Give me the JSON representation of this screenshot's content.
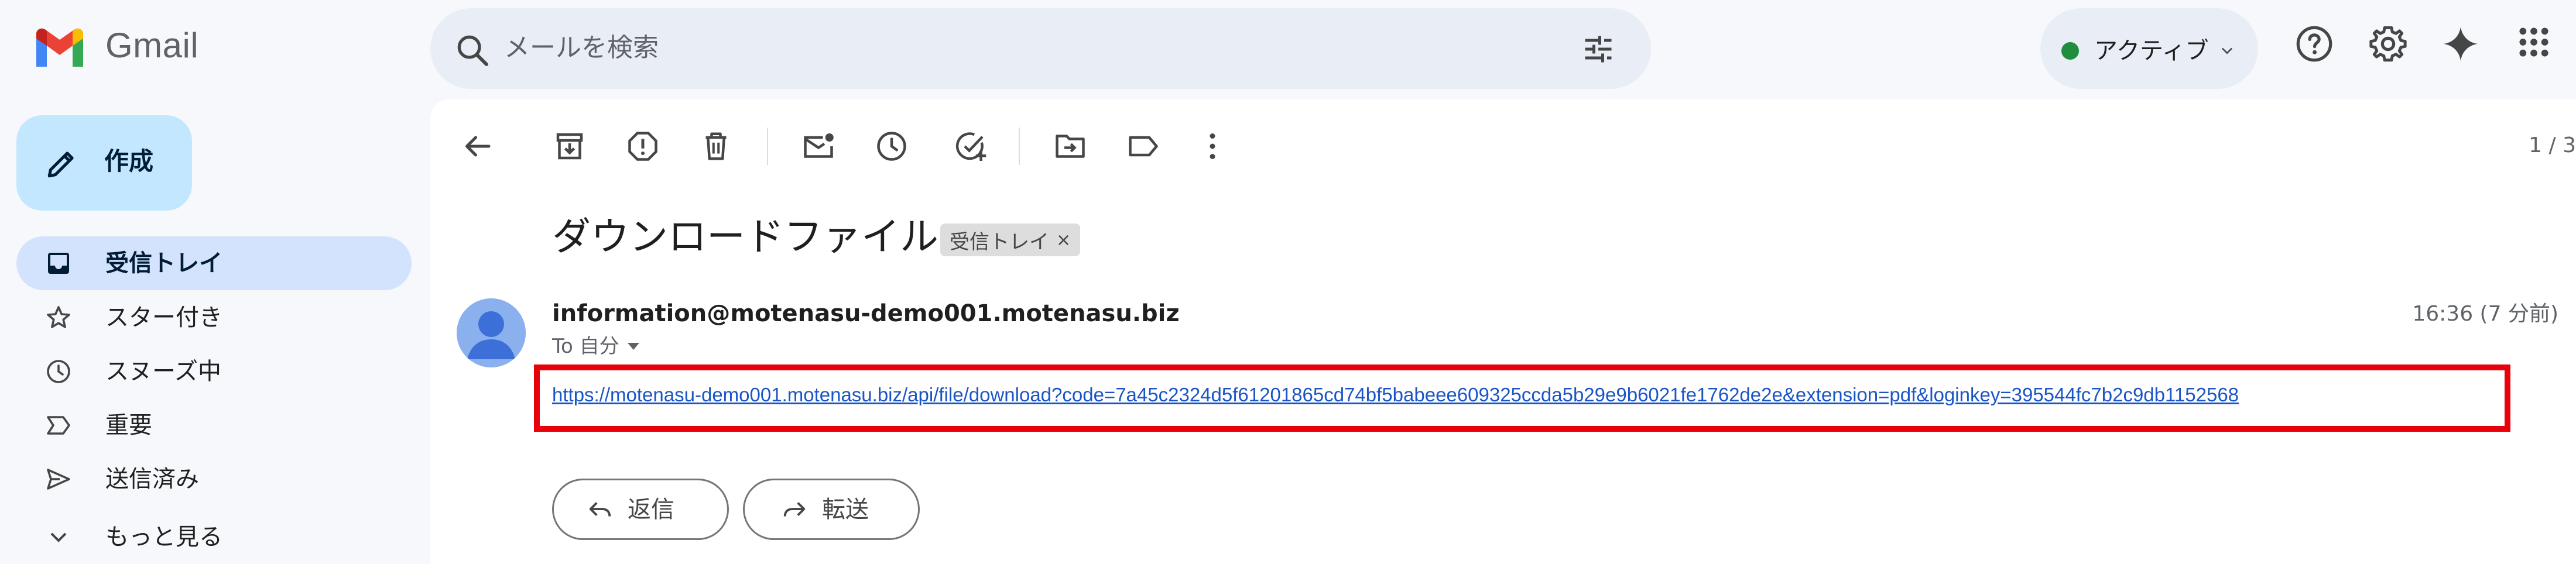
{
  "header": {
    "brand": "Gmail",
    "search_placeholder": "メールを検索",
    "status_label": "アクティブ"
  },
  "sidebar": {
    "compose_label": "作成",
    "items": [
      {
        "label": "受信トレイ",
        "icon": "inbox-icon",
        "active": true
      },
      {
        "label": "スター付き",
        "icon": "star-icon"
      },
      {
        "label": "スヌーズ中",
        "icon": "snooze-clock-icon"
      },
      {
        "label": "重要",
        "icon": "important-icon"
      },
      {
        "label": "送信済み",
        "icon": "send-icon"
      },
      {
        "label": "もっと見る",
        "icon": "chevron-down-icon"
      }
    ]
  },
  "toolbar": {
    "page_count": "1 / 3"
  },
  "message": {
    "subject": "ダウンロードファイル",
    "label_chip": "受信トレイ",
    "label_chip_close": "×",
    "sender": "information@motenasu-demo001.motenasu.biz",
    "to_line": "To 自分",
    "time": "16:36 (7 分前)",
    "link": "https://motenasu-demo001.motenasu.biz/api/file/download?code=7a45c2324d5f61201865cd74bf5babeee609325ccda5b29e9b6021fe1762de2e&extension=pdf&loginkey=395544fc7b2c9db1152568"
  },
  "actions": {
    "reply_label": "返信",
    "forward_label": "転送"
  },
  "colors": {
    "accent_blue": "#c2e7ff",
    "active_nav": "#d3e3fd",
    "status_green": "#1e8e3e",
    "highlight_red": "#e8000b",
    "link_blue": "#1a55c8"
  }
}
